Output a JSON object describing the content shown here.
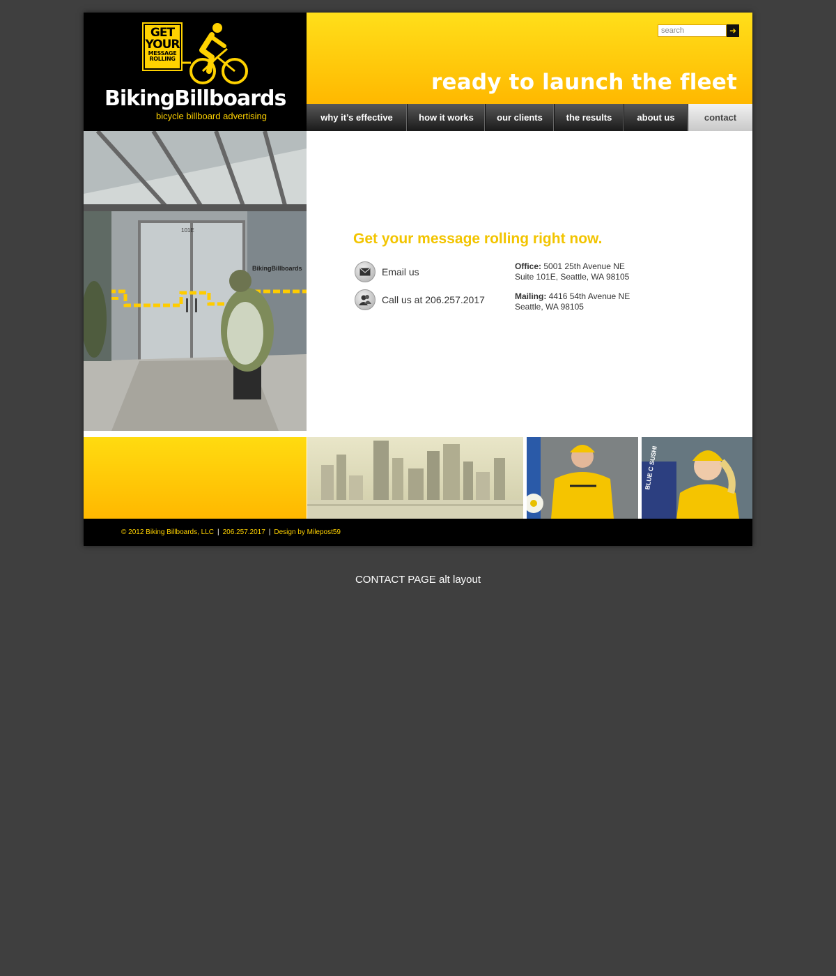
{
  "header": {
    "logo_sign": [
      "GET",
      "YOUR",
      "MESSAGE",
      "ROLLING"
    ],
    "logo_name": "BikingBillboards",
    "logo_tagline": "bicycle billboard advertising",
    "search_placeholder": "search",
    "banner_tagline": "ready to launch the fleet"
  },
  "nav": [
    {
      "label": "why it’s effective"
    },
    {
      "label": "how it works"
    },
    {
      "label": "our clients"
    },
    {
      "label": "the results"
    },
    {
      "label": "about us"
    },
    {
      "label": "contact"
    }
  ],
  "photo": {
    "door_sign": "101E",
    "window_logo": "BikingBillboards"
  },
  "main": {
    "headline": "Get your message rolling right now.",
    "email_label": "Email us",
    "call_label": "Call us at 206.257.2017",
    "office_label": "Office:",
    "office_line1": "5001 25th Avenue NE",
    "office_line2": "Suite 101E, Seattle, WA 98105",
    "mailing_label": "Mailing:",
    "mailing_line1": "4416 54th Avenue NE",
    "mailing_line2": "Seattle, WA 98105"
  },
  "strip": {
    "sign_text": "BLUE C SUSHI"
  },
  "footer": {
    "copyright": "© 2012 Biking Billboards, LLC",
    "phone": "206.257.2017",
    "credit": "Design by Milepost59"
  },
  "caption": "CONTACT PAGE alt layout"
}
